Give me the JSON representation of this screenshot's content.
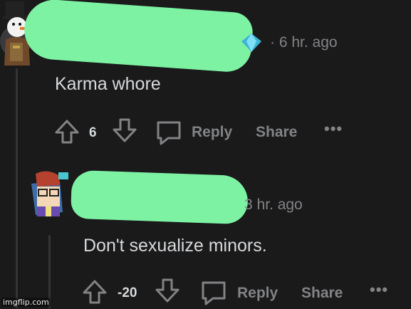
{
  "comments": [
    {
      "flair_icon": "diamond-flair-icon",
      "time": "· 6 hr. ago",
      "body": "Karma whore",
      "score": "6",
      "reply_label": "Reply",
      "share_label": "Share",
      "more_label": "•••"
    },
    {
      "time": "3 hr. ago",
      "body": "Don't sexualize minors.",
      "score": "-20",
      "reply_label": "Reply",
      "share_label": "Share",
      "more_label": "•••"
    }
  ],
  "watermark": "imgflip.com",
  "colors": {
    "background": "#1a1a1b",
    "text": "#d7dadc",
    "muted": "#818384",
    "thread_line": "#343536",
    "redaction": "#7ef2a3"
  }
}
